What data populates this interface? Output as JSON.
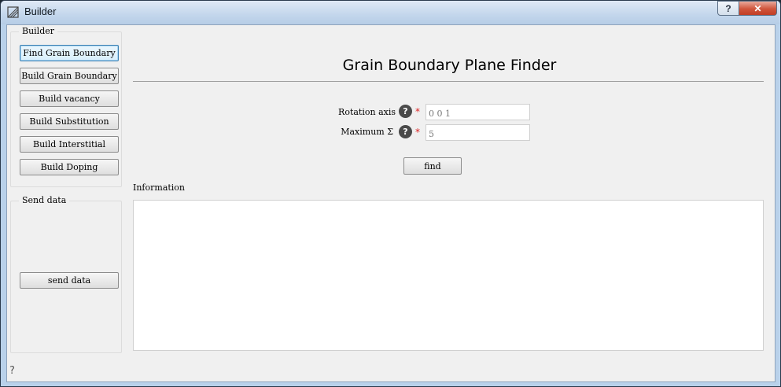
{
  "window": {
    "title": "Builder",
    "help_button": "?",
    "close_button": "✕"
  },
  "builder_group": {
    "title": "Builder",
    "buttons": [
      "Find Grain Boundary",
      "Build Grain Boundary",
      "Build vacancy",
      "Build Substitution",
      "Build Interstitial",
      "Build Doping"
    ]
  },
  "send_group": {
    "title": "Send data",
    "button": "send data"
  },
  "main": {
    "title": "Grain Boundary Plane Finder",
    "rotation_axis": {
      "label": "Rotation axis",
      "value": "0 0 1"
    },
    "maximum_sigma": {
      "label": "Maximum Σ",
      "value": "5"
    },
    "help_glyph": "?",
    "required_mark": "*",
    "find_button": "find",
    "information_label": "Information",
    "information_text": ""
  },
  "status_bar": {
    "help_glyph": "?"
  },
  "colors": {
    "titlebar": "#c3d6ec",
    "close_button": "#c13d24",
    "required": "#dd2222",
    "focus_border": "#3c7fb1"
  }
}
